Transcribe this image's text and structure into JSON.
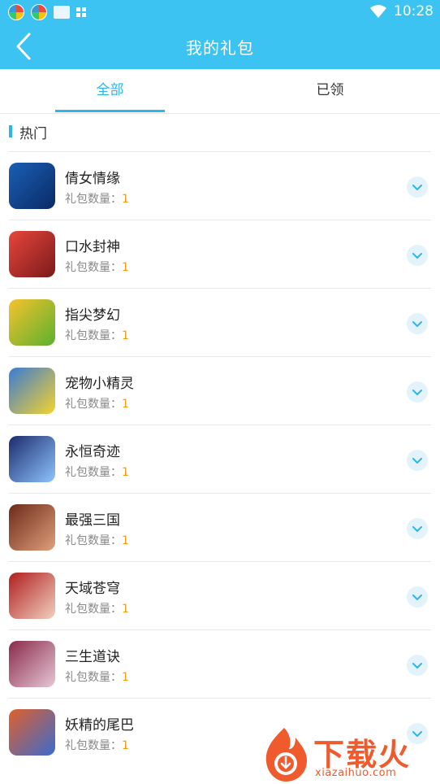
{
  "status_bar": {
    "time": "10:28",
    "icons": [
      "app-notification-icon",
      "app-notification-icon",
      "screen-icon",
      "grid-icon",
      "wifi-icon"
    ]
  },
  "header": {
    "title": "我的礼包",
    "back_icon": "chevron-left-icon"
  },
  "tabs": [
    {
      "label": "全部",
      "active": true
    },
    {
      "label": "已领",
      "active": false
    }
  ],
  "section": {
    "label": "热门"
  },
  "gift_count_label": "礼包数量：",
  "games": [
    {
      "name": "倩女情缘",
      "count": "1",
      "colors": [
        "#1a5fb4",
        "#0a2a66"
      ]
    },
    {
      "name": "口水封神",
      "count": "1",
      "colors": [
        "#e8453c",
        "#7a1a1a"
      ]
    },
    {
      "name": "指尖梦幻",
      "count": "1",
      "colors": [
        "#f6c22c",
        "#5bb12f"
      ]
    },
    {
      "name": "宠物小精灵",
      "count": "1",
      "colors": [
        "#3a7bd5",
        "#f6d32d"
      ]
    },
    {
      "name": "永恒奇迹",
      "count": "1",
      "colors": [
        "#1c2a6b",
        "#8ec5ff"
      ]
    },
    {
      "name": "最强三国",
      "count": "1",
      "colors": [
        "#6b2a1a",
        "#e0a07a"
      ]
    },
    {
      "name": "天域苍穹",
      "count": "1",
      "colors": [
        "#b01e1e",
        "#f2d0c0"
      ]
    },
    {
      "name": "三生道诀",
      "count": "1",
      "colors": [
        "#8a2a4a",
        "#e6c7d6"
      ]
    },
    {
      "name": "妖精的尾巴",
      "count": "1",
      "colors": [
        "#e0602a",
        "#3a6bd0"
      ]
    }
  ],
  "watermark": {
    "cn": "下载火",
    "en": "xiazaihuo.com"
  },
  "colors": {
    "accent": "#3cc3f2",
    "tab_active": "#2fb4ee",
    "count": "#f39c12"
  }
}
